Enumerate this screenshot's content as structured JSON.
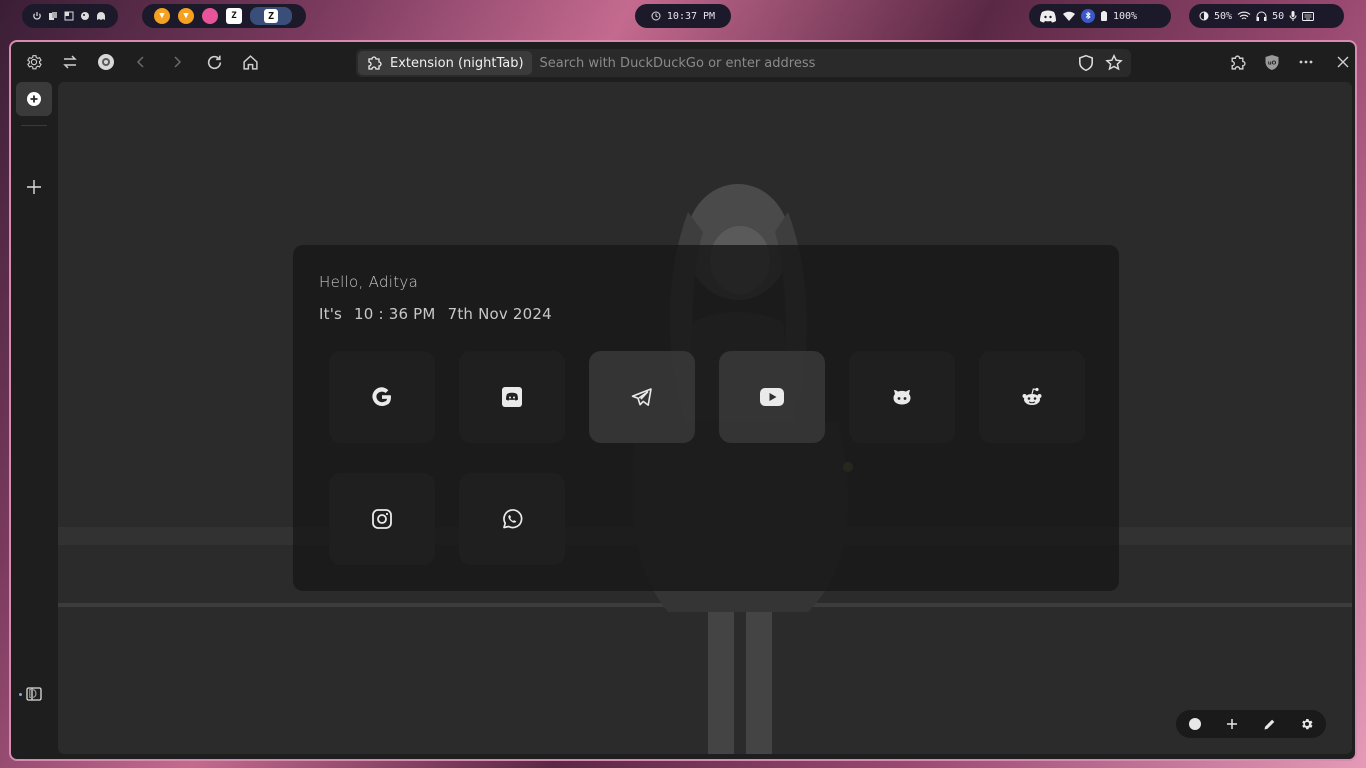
{
  "topbar": {
    "clock": "10:37 PM",
    "battery": "100%",
    "brightness": "50%",
    "volume": "50",
    "apps": [
      "brave-icon",
      "brave-icon",
      "pink-app-icon",
      "zed-icon",
      "zed-icon"
    ]
  },
  "browser": {
    "extension_chip": "Extension (nightTab)",
    "search_placeholder": "Search with DuckDuckGo or enter address",
    "workspace_label": "D"
  },
  "nighttab": {
    "greeting": "Hello, Aditya",
    "its": "It's",
    "time": "10 : 36 PM",
    "date": "7th Nov 2024",
    "bookmarks": [
      {
        "name": "google",
        "icon": "google-icon"
      },
      {
        "name": "discord",
        "icon": "discord-icon"
      },
      {
        "name": "telegram",
        "icon": "telegram-icon"
      },
      {
        "name": "youtube",
        "icon": "youtube-icon"
      },
      {
        "name": "github",
        "icon": "github-icon"
      },
      {
        "name": "reddit",
        "icon": "reddit-icon"
      },
      {
        "name": "instagram",
        "icon": "instagram-icon"
      },
      {
        "name": "whatsapp",
        "icon": "whatsapp-icon"
      }
    ]
  },
  "colors": {
    "window_border": "#d88bb0",
    "panel_bg": "#181818",
    "accent_blue": "#7aa6ff"
  }
}
